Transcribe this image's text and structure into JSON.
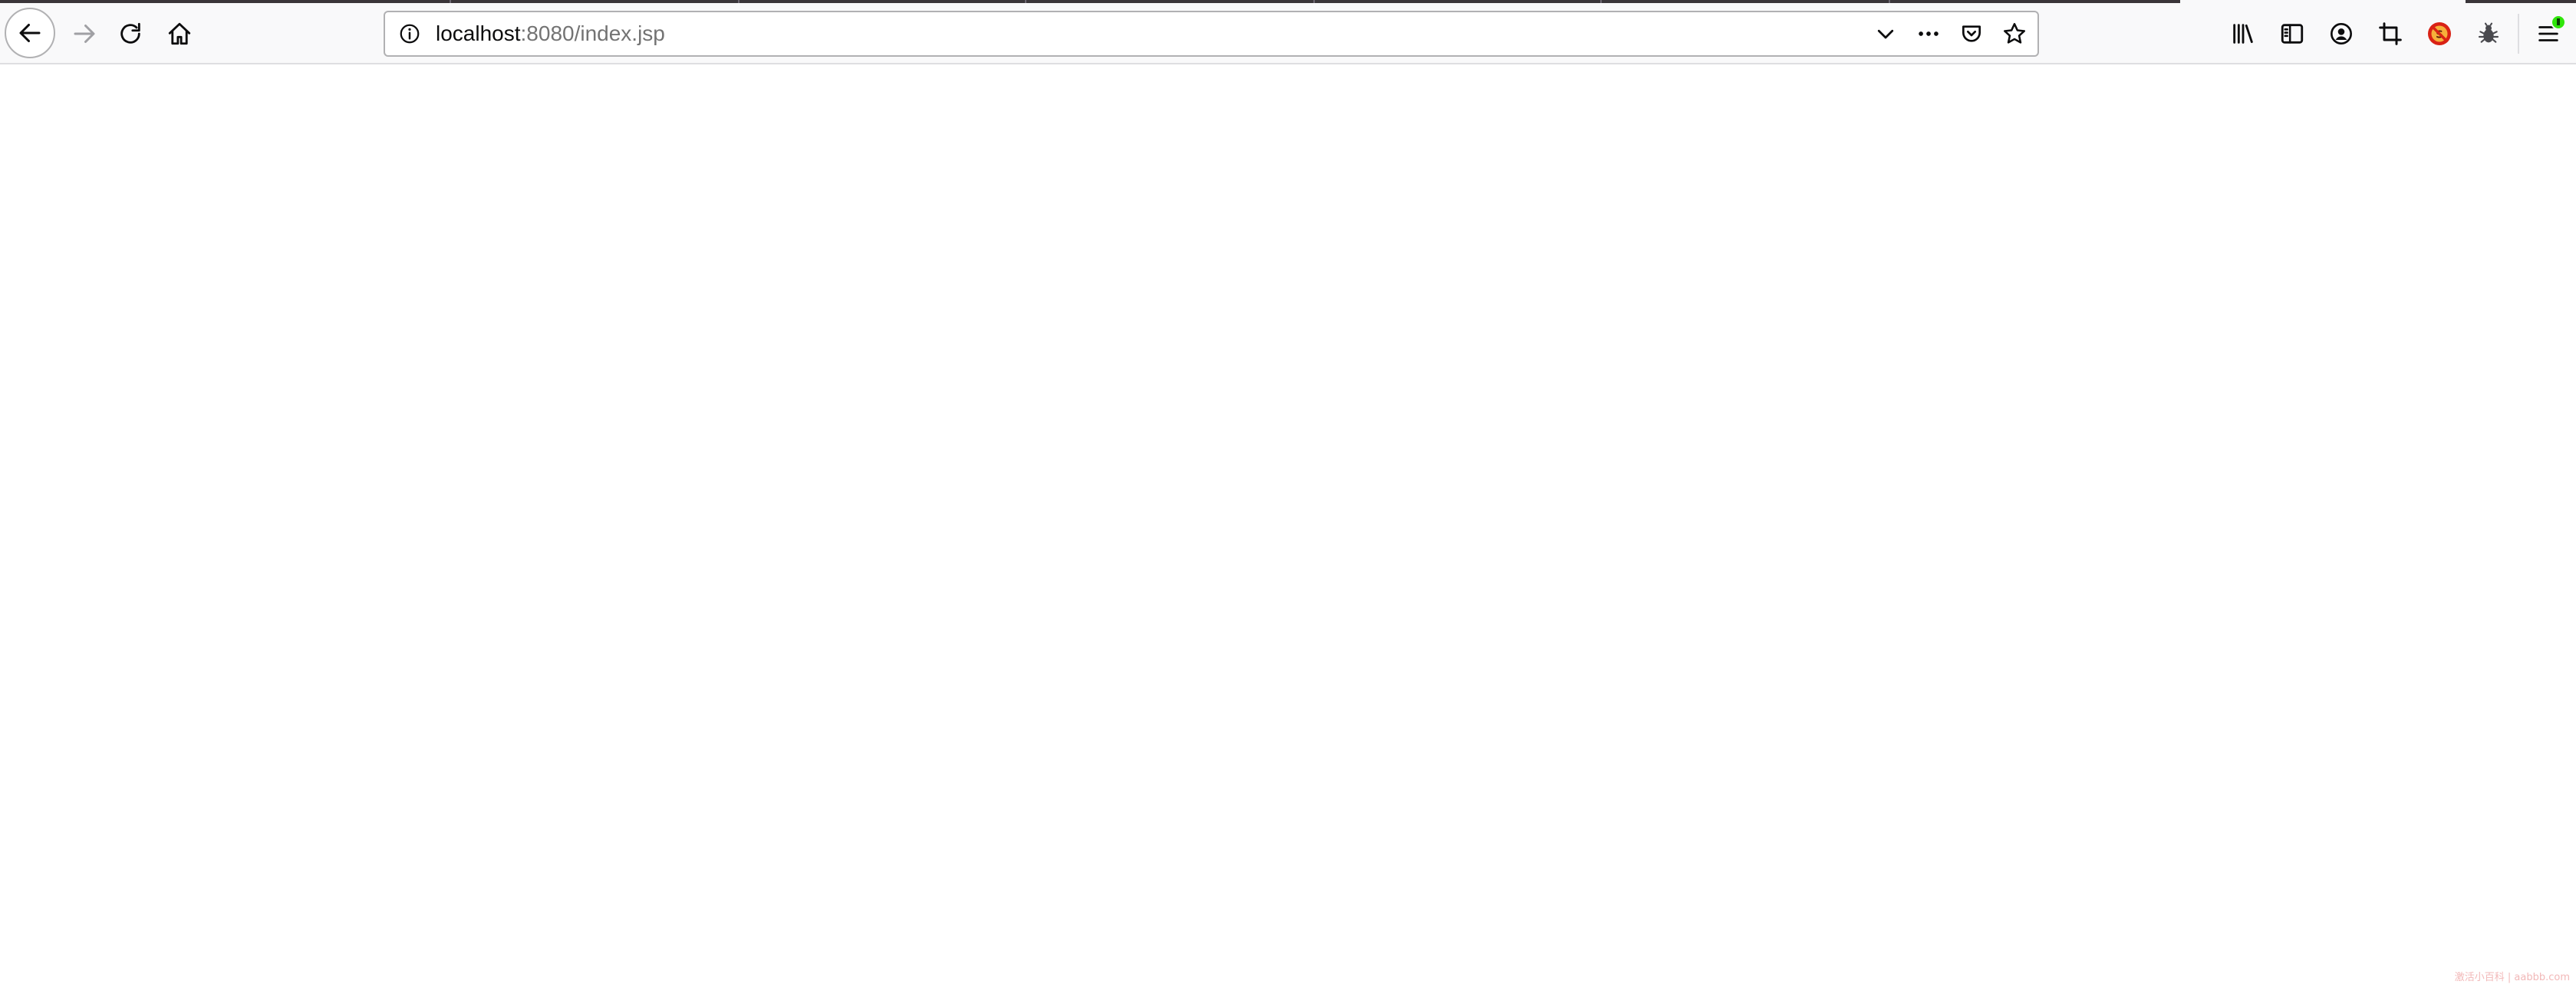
{
  "browser": {
    "url_host": "localhost",
    "url_rest": ":8080/index.jsp",
    "accent_color": "#0a84ff"
  },
  "toolbar": {
    "back_icon": "arrow-left-icon",
    "forward_icon": "arrow-right-icon",
    "reload_icon": "reload-icon",
    "home_icon": "home-icon",
    "site_info_icon": "info-circle-icon",
    "dropdown_icon": "chevron-down-icon",
    "page_actions_icon": "ellipsis-icon",
    "pocket_icon": "pocket-icon",
    "bookmark_icon": "star-icon",
    "library_icon": "library-icon",
    "sidebar_icon": "sidebar-icon",
    "account_icon": "account-icon",
    "screenshot_icon": "crop-icon",
    "blocker_icon": "no-script-icon",
    "bug_icon": "bug-icon",
    "menu_icon": "hamburger-menu-icon",
    "update_badge_color": "#30e60b"
  },
  "watermark": "激活小百科 | aabbb.com"
}
